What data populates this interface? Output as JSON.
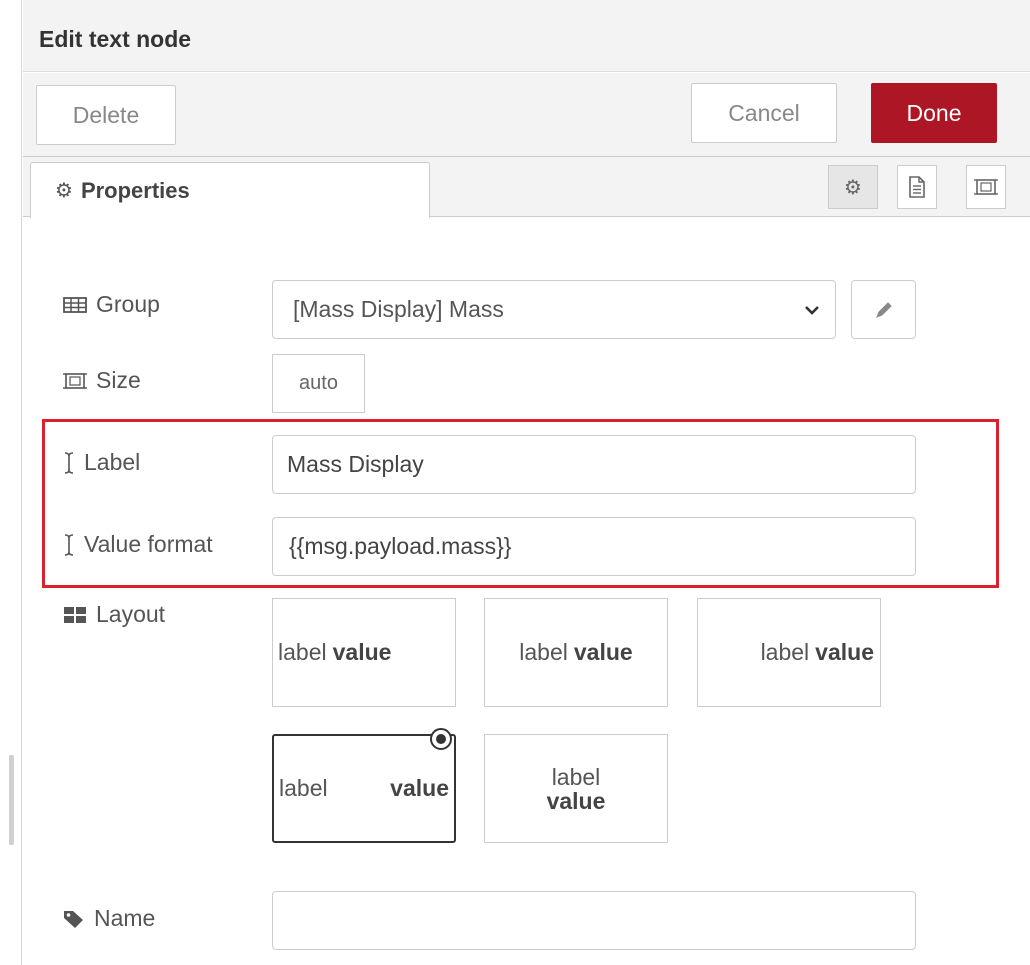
{
  "header": {
    "title": "Edit text node"
  },
  "toolbar": {
    "delete_label": "Delete",
    "cancel_label": "Cancel",
    "done_label": "Done",
    "done_color": "#ad1625"
  },
  "tabs": {
    "properties_label": "Properties",
    "icons": [
      "gear-icon",
      "description-icon",
      "appearance-icon"
    ]
  },
  "form": {
    "group": {
      "label": "Group",
      "value": "[Mass Display] Mass"
    },
    "size": {
      "label": "Size",
      "value": "auto"
    },
    "label": {
      "label": "Label",
      "value": "Mass Display"
    },
    "value_format": {
      "label": "Value format",
      "value": "{{msg.payload.mass}}"
    },
    "layout": {
      "label": "Layout",
      "options": [
        {
          "label": "label",
          "value": "value"
        },
        {
          "label": "label",
          "value": "value"
        },
        {
          "label": "label",
          "value": "value"
        },
        {
          "label": "label",
          "value": "value"
        },
        {
          "label": "label",
          "value": "value"
        }
      ],
      "selected_index": 3
    },
    "name": {
      "label": "Name",
      "value": ""
    }
  },
  "highlight_color": "#d9222d"
}
